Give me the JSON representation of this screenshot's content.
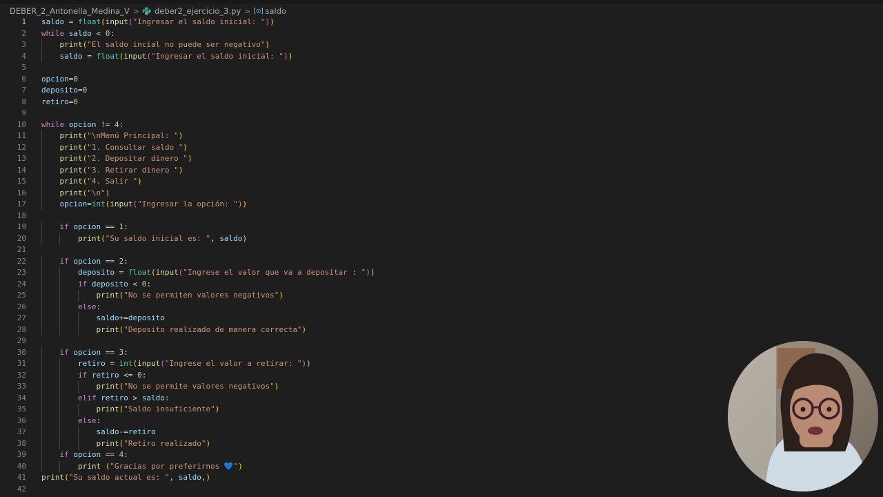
{
  "breadcrumb": {
    "folder": "DEBER_2_Antonella_Medina_V",
    "file": "deber2_ejercicio_3.py",
    "symbol": "saldo",
    "separator": ">",
    "symbol_icon": "[⊙]"
  },
  "editor": {
    "language": "python",
    "active_line": 1,
    "lines": [
      "saldo = float(input(\"Ingresar el saldo inicial: \"))",
      "while saldo < 0:",
      "    print(\"El saldo incial no puede ser negativo\")",
      "    saldo = float(input(\"Ingresar el saldo inicial: \"))",
      "",
      "opcion=0",
      "deposito=0",
      "retiro=0",
      "",
      "while opcion != 4:",
      "    print(\"\\nMenú Principal: \")",
      "    print(\"1. Consultar saldo \")",
      "    print(\"2. Depositar dinero \")",
      "    print(\"3. Retirar dinero \")",
      "    print(\"4. Salir \")",
      "    print(\"\\n\")",
      "    opcion=int(input(\"Ingresar la opción: \"))",
      "",
      "    if opcion == 1:",
      "        print(\"Su saldo inicial es: \", saldo)",
      "",
      "    if opcion == 2:",
      "        deposito = float(input(\"Ingrese el valor que va a depositar : \"))",
      "        if deposito < 0:",
      "            print(\"No se permiten valores negativos\")",
      "        else:",
      "            saldo+=deposito",
      "            print(\"Deposito realizado de manera correcta\")",
      "",
      "    if opcion == 3:",
      "        retiro = int(input(\"Ingrese el valor a retirar: \"))",
      "        if retiro <= 0:",
      "            print(\"No se permite valores negativos\")",
      "        elif retiro > saldo:",
      "            print(\"Saldo insuficiente\")",
      "        else:",
      "            saldo-=retiro",
      "            print(\"Retiro realizado\")",
      "    if opcion == 4:",
      "        print (\"Gracias por preferirnos 💙\")",
      "print(\"Su saldo actual es: \", saldo,)",
      ""
    ]
  },
  "colors": {
    "background": "#1e1e1e",
    "keyword": "#c586c0",
    "variable": "#9cdcfe",
    "function": "#dcdcaa",
    "string": "#ce9178",
    "number": "#b5cea8",
    "builtin_type": "#4ec9b0",
    "bracket_level_1": "#ffd700",
    "bracket_level_2": "#da70d6",
    "line_number": "#858585"
  },
  "webcam": {
    "icon": "presenter-webcam-icon"
  }
}
